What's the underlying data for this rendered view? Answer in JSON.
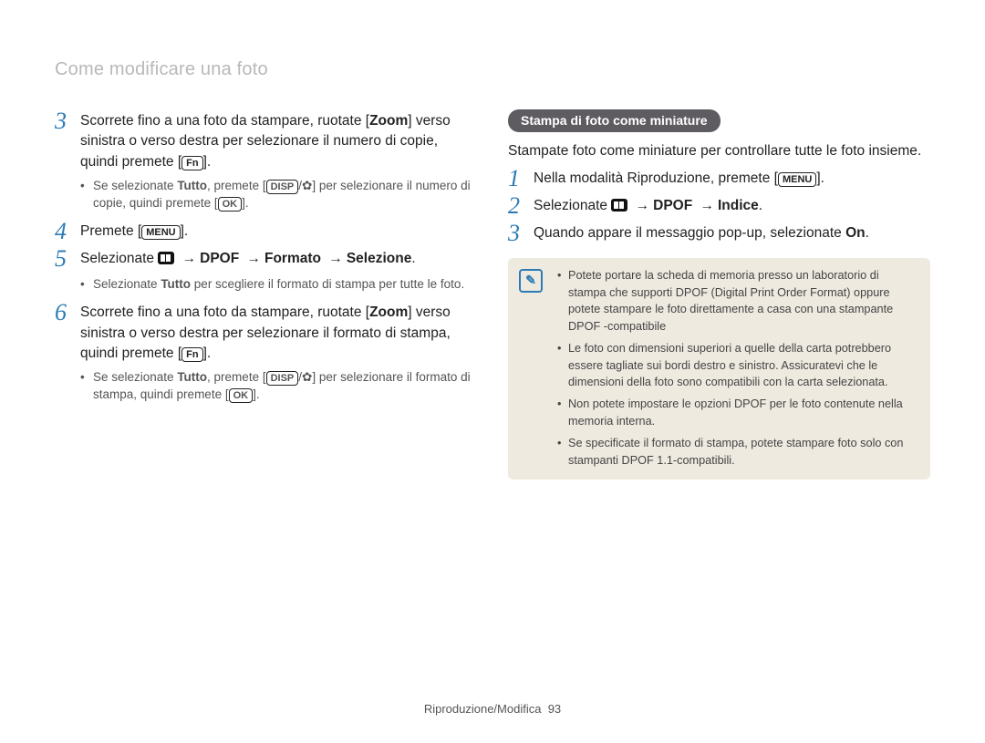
{
  "header": {
    "title": "Come modificare una foto"
  },
  "buttons": {
    "fn": "Fn",
    "menu": "MENU",
    "disp": "DISP",
    "ok": "OK"
  },
  "arrow": "→",
  "flower": "✿",
  "left": {
    "s3": {
      "num": "3",
      "t1": "Scorrete fino a una foto da stampare, ruotate [",
      "t1b": "Zoom",
      "t2": "] verso sinistra o verso destra per selezionare il numero di copie, quindi premete [",
      "t3": "].",
      "sub_a": "Se selezionate ",
      "sub_b": "Tutto",
      "sub_c": ", premete [",
      "sub_d": "/",
      "sub_e": "] per selezionare il numero di copie, quindi premete [",
      "sub_f": "]."
    },
    "s4": {
      "num": "4",
      "t1": "Premete [",
      "t2": "]."
    },
    "s5": {
      "num": "5",
      "t1": "Selezionate ",
      "p1": "DPOF",
      "p2": "Formato",
      "p3": "Selezione",
      "sub_a": "Selezionate ",
      "sub_b": "Tutto",
      "sub_c": " per scegliere il formato di stampa per tutte le foto."
    },
    "s6": {
      "num": "6",
      "t1": "Scorrete fino a una foto da stampare, ruotate [",
      "t1b": "Zoom",
      "t2": "] verso sinistra o verso destra per selezionare il formato di stampa, quindi premete [",
      "t3": "].",
      "sub_a": "Se selezionate ",
      "sub_b": "Tutto",
      "sub_c": ", premete [",
      "sub_d": "/",
      "sub_e": "] per selezionare il formato di stampa, quindi premete [",
      "sub_f": "]."
    }
  },
  "right": {
    "pill": "Stampa di foto come miniature",
    "intro": "Stampate foto come miniature per controllare tutte le foto insieme.",
    "s1": {
      "num": "1",
      "t1": "Nella modalità Riproduzione, premete [",
      "t2": "]."
    },
    "s2": {
      "num": "2",
      "t1": "Selezionate ",
      "p1": "DPOF",
      "p2": "Indice",
      "dot": "."
    },
    "s3": {
      "num": "3",
      "t1": "Quando appare il messaggio pop-up, selezionate ",
      "t1b": "On",
      "dot": "."
    },
    "notes": [
      "Potete portare la scheda di memoria presso un laboratorio di stampa che supporti DPOF (Digital Print Order Format) oppure potete stampare le foto direttamente a casa con una stampante DPOF -compatibile",
      "Le foto con dimensioni superiori a quelle della carta potrebbero essere tagliate sui bordi destro e sinistro. Assicuratevi che le dimensioni della foto sono compatibili con la carta selezionata.",
      "Non potete impostare le opzioni DPOF per le foto contenute nella memoria interna.",
      "Se specificate il formato di stampa, potete stampare foto solo con stampanti DPOF 1.1-compatibili."
    ]
  },
  "footer": {
    "section": "Riproduzione/Modifica",
    "page": "93"
  }
}
